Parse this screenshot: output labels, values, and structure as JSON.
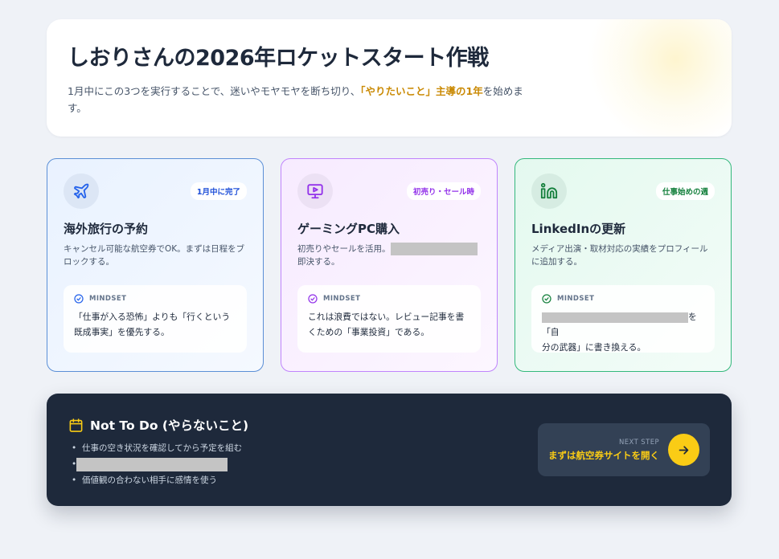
{
  "header": {
    "title": "しおりさんの2026年ロケットスタート作戦",
    "desc_before": "1月中にこの3つを実行することで、迷いやモヤモヤを断ち切り、",
    "desc_highlight": "「やりたいこと」主導の1年",
    "desc_after": "を始めます。"
  },
  "cards": [
    {
      "icon": "airplane-icon",
      "badge": "1月中に完了",
      "title": "海外旅行の予約",
      "desc": "キャンセル可能な航空券でOK。まずは日程をブロックする。",
      "mindset_label": "MINDSET",
      "mindset_text": "「仕事が入る恐怖」よりも「行くという既成事実」を優先する。"
    },
    {
      "icon": "monitor-play-icon",
      "badge": "初売り・セール時",
      "title": "ゲーミングPC購入",
      "desc_before": "初売りやセールを活用。",
      "desc_after": "即決する。",
      "mindset_label": "MINDSET",
      "mindset_text": "これは浪費ではない。レビュー記事を書くための「事業投資」である。"
    },
    {
      "icon": "linkedin-icon",
      "badge": "仕事始めの週",
      "title": "LinkedInの更新",
      "desc": "メディア出演・取材対応の実績をプロフィールに追加する。",
      "mindset_label": "MINDSET",
      "mindset_text_after_1": "を「自",
      "mindset_text_after_2": "分の武器」に書き換える。"
    }
  ],
  "not_to_do": {
    "title": "Not To Do (やらないこと)",
    "items": [
      "仕事の空き状況を確認してから予定を組む",
      "",
      "価値観の合わない相手に感情を使う"
    ]
  },
  "next_step": {
    "label": "NEXT STEP",
    "action": "まずは航空券サイトを開く"
  },
  "colors": {
    "accent_yellow": "#facc15",
    "highlight_text": "#ca8a04",
    "dark_panel": "#1e293b",
    "blue": "#2563eb",
    "purple": "#9333ea",
    "green": "#15803d"
  }
}
